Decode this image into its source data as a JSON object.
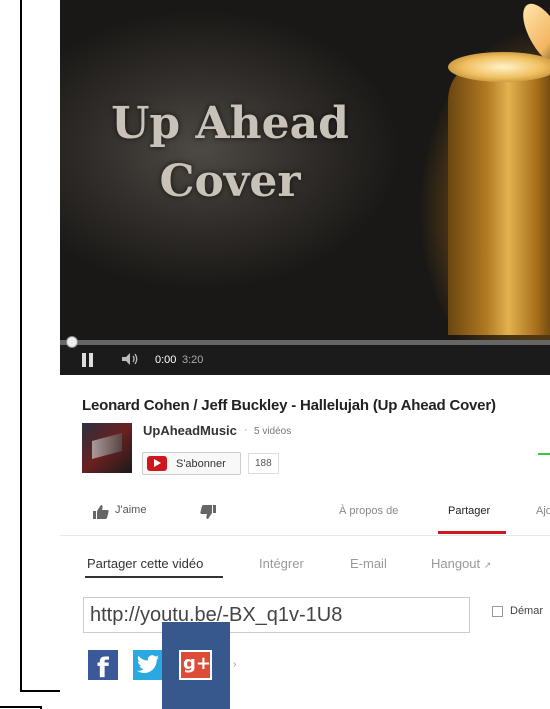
{
  "video": {
    "overlay_title_line1": "Up Ahead",
    "overlay_title_line2": "Cover",
    "progress": 0.0,
    "current_time": "0:00",
    "total_time": "3:20"
  },
  "info": {
    "title": "Leonard Cohen / Jeff Buckley - Hallelujah (Up Ahead Cover)",
    "channel": {
      "name": "UpAheadMusic",
      "separator": "·",
      "video_count": "5 vidéos",
      "subscribe_label": "S'abonner",
      "subscriber_count": "188"
    },
    "actions": {
      "like_label": "J'aime",
      "tabs": [
        "À propos de",
        "Partager",
        "Ajo"
      ],
      "active_tab": "Partager"
    }
  },
  "share": {
    "tabs": [
      "Partager cette vidéo",
      "Intégrer",
      "E-mail",
      "Hangout"
    ],
    "active_tab": "Partager cette vidéo",
    "url": "http://youtu.be/-BX_q1v-1U8",
    "start_at_label": "Démar",
    "social": [
      "facebook-icon",
      "twitter-icon",
      "google-plus-icon"
    ],
    "more_symbol": "›"
  },
  "colors": {
    "accent_red": "#cc181e",
    "highlight_blue": "#37588d",
    "facebook": "#3b5998",
    "twitter": "#2aa9e0",
    "google_plus": "#dd4b39"
  }
}
